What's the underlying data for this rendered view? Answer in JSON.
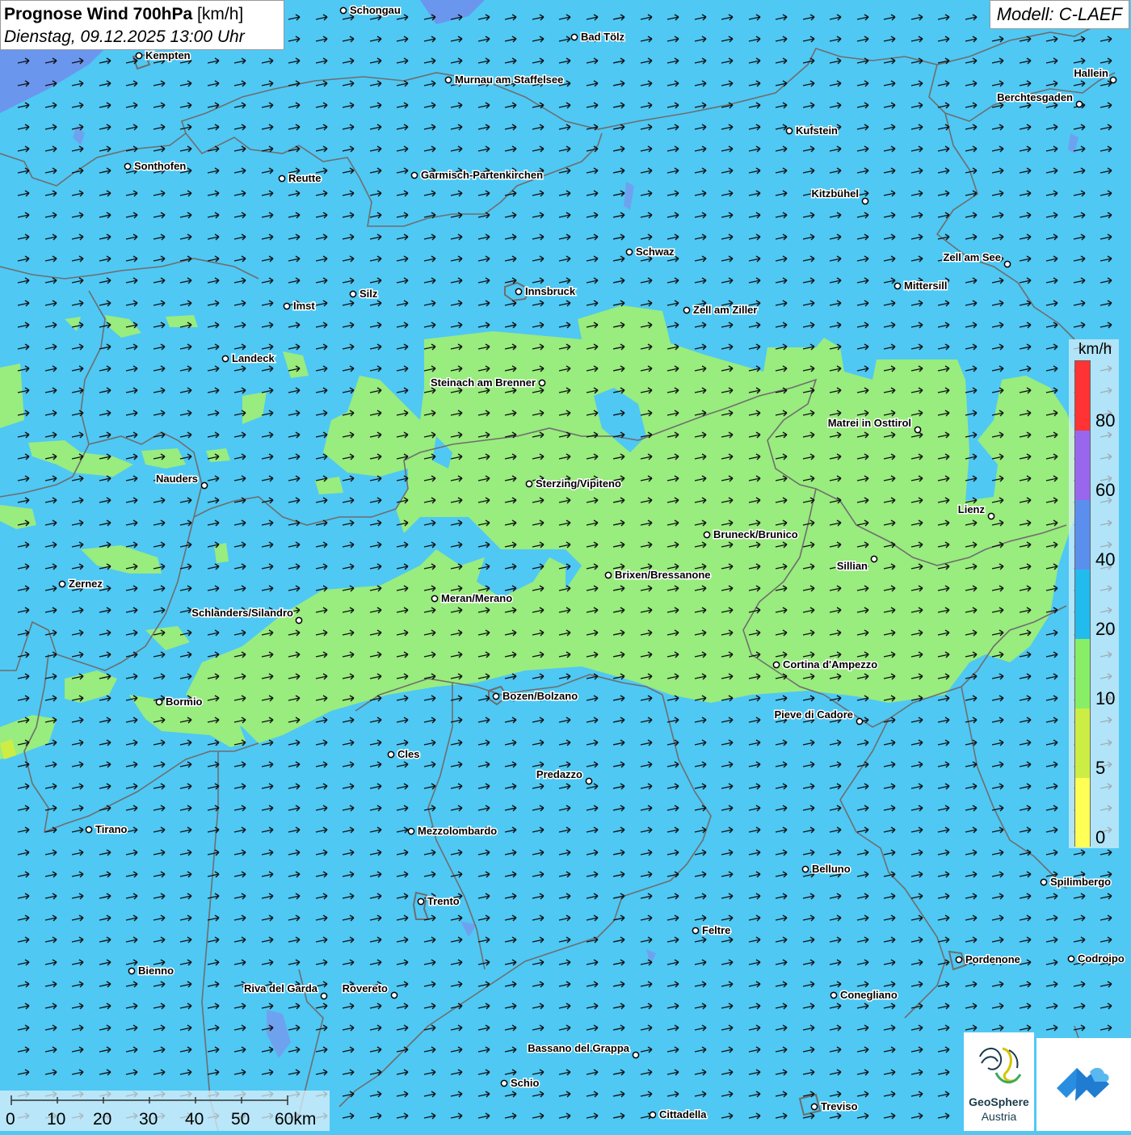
{
  "title": {
    "main_bold": "Prognose Wind 700hPa",
    "main_unit": " [km/h]",
    "sub": "Dienstag, 09.12.2025 13:00 Uhr"
  },
  "model_label": "Modell: C-LAEF",
  "legend": {
    "unit": "km/h",
    "ticks": [
      "80",
      "60",
      "40",
      "20",
      "10",
      "5",
      "0"
    ],
    "colors": [
      "#ff3333",
      "#9966ee",
      "#5b8fee",
      "#22bbee",
      "#88ee66",
      "#ccee44",
      "#ffff55"
    ]
  },
  "scale": {
    "labels": [
      "0",
      "10",
      "20",
      "30",
      "40",
      "50",
      "60km"
    ]
  },
  "colors": {
    "background_wind": "#4fc8f4",
    "green_zone": "#99ec7e",
    "borders": "#6e6e6e",
    "lakes": "#6fa2ee"
  },
  "logo": {
    "name": "GeoSphere",
    "sub": "Austria"
  },
  "cities": [
    {
      "name": "Schongau"
    },
    {
      "name": "Bad Tölz"
    },
    {
      "name": "Kempten"
    },
    {
      "name": "Murnau am Staffelsee"
    },
    {
      "name": "Hallein"
    },
    {
      "name": "Berchtesgaden"
    },
    {
      "name": "Kufstein"
    },
    {
      "name": "Sonthofen"
    },
    {
      "name": "Reutte"
    },
    {
      "name": "Garmisch-Partenkirchen"
    },
    {
      "name": "Kitzbühel"
    },
    {
      "name": "Schwaz"
    },
    {
      "name": "Zell am See"
    },
    {
      "name": "Mittersill"
    },
    {
      "name": "Innsbruck"
    },
    {
      "name": "Silz"
    },
    {
      "name": "Imst"
    },
    {
      "name": "Zell am Ziller"
    },
    {
      "name": "Landeck"
    },
    {
      "name": "Steinach am Brenner"
    },
    {
      "name": "Matrei in Osttirol"
    },
    {
      "name": "Nauders"
    },
    {
      "name": "Sterzing/Vipiteno"
    },
    {
      "name": "Lienz"
    },
    {
      "name": "Bruneck/Brunico"
    },
    {
      "name": "Sillian"
    },
    {
      "name": "Brixen/Bressanone"
    },
    {
      "name": "Zernez"
    },
    {
      "name": "Meran/Merano"
    },
    {
      "name": "Schlanders/Silandro"
    },
    {
      "name": "Cortina d'Ampezzo"
    },
    {
      "name": "Bozen/Bolzano"
    },
    {
      "name": "Bormio"
    },
    {
      "name": "Pieve di Cadore"
    },
    {
      "name": "Cles"
    },
    {
      "name": "Predazzo"
    },
    {
      "name": "Tirano"
    },
    {
      "name": "Mezzolombardo"
    },
    {
      "name": "Belluno"
    },
    {
      "name": "Spilimbergo"
    },
    {
      "name": "Trento"
    },
    {
      "name": "Feltre"
    },
    {
      "name": "Pordenone"
    },
    {
      "name": "Codroipo"
    },
    {
      "name": "Bienno"
    },
    {
      "name": "Riva del Garda"
    },
    {
      "name": "Rovereto"
    },
    {
      "name": "Conegliano"
    },
    {
      "name": "Bassano del Grappa"
    },
    {
      "name": "Schio"
    },
    {
      "name": "Treviso"
    },
    {
      "name": "Cittadella"
    }
  ]
}
